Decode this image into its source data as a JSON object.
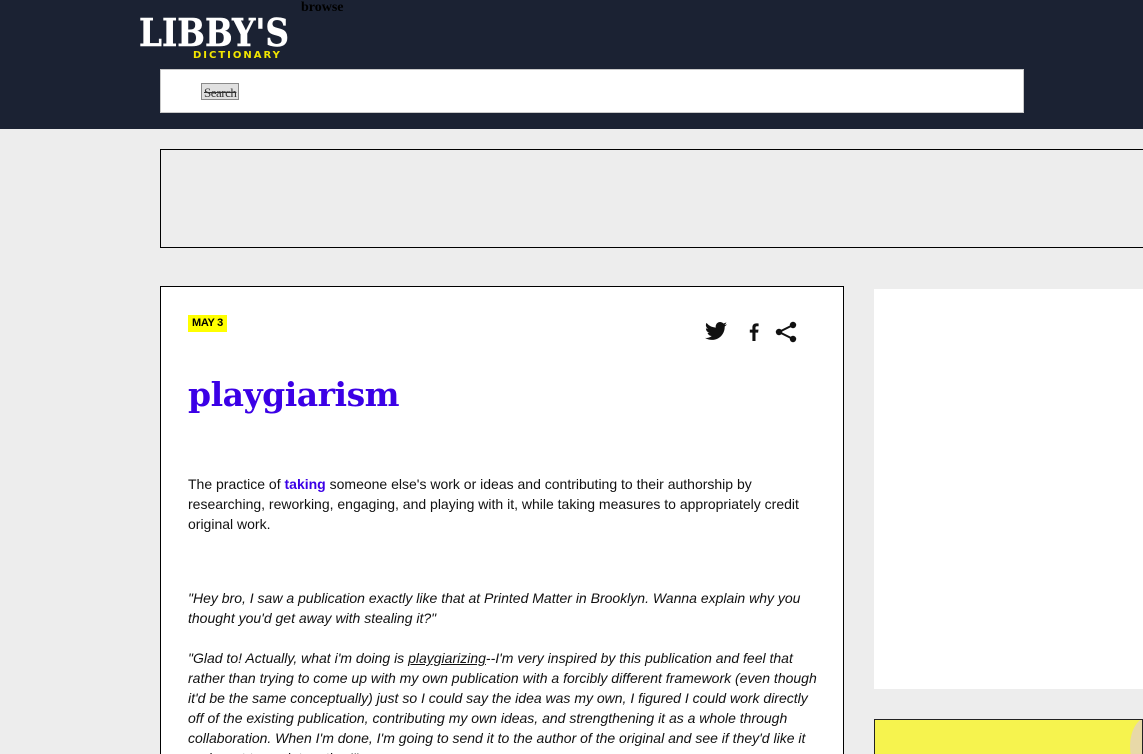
{
  "header": {
    "logo_text": "LIBBY'S",
    "logo_subtext": "DICTIONARY",
    "browse_label": "browse",
    "search_button_label": "Search",
    "search_placeholder": ""
  },
  "entry": {
    "date": "MAY 3",
    "word": "playgiarism",
    "definition_before": "The practice of ",
    "definition_link": "taking",
    "definition_after": " someone else's work or ideas and contributing to their authorship by researching, reworking, engaging, and playing with it, while taking measures to appropriately credit original work.",
    "example_1": "\"Hey bro, I saw a publication exactly like that at Printed Matter in Brooklyn. Wanna explain why you thought you'd get away with stealing it?\"",
    "example_2_before": "\"Glad to! Actually, what i'm doing is ",
    "example_2_link": "playgiarizing",
    "example_2_after": "--I'm very inspired by this publication and feel that rather than trying to come up with my own publication with a forcibly different framework (even though it'd be the same conceptually) just so I could say the idea was my own, I figured I could work directly off of the existing publication, contributing my own ideas, and strengthening it as a whole through collaboration. When I'm done, I'm going to send it to the author of the original and see if they'd like it and want to work together!\""
  },
  "share": {
    "icons": [
      "twitter-icon",
      "facebook-icon",
      "share-icon"
    ]
  },
  "colors": {
    "header_bg": "#1b2233",
    "accent": "#3b00e6",
    "highlight": "#ffff00",
    "logo_yellow": "#f2e600"
  }
}
